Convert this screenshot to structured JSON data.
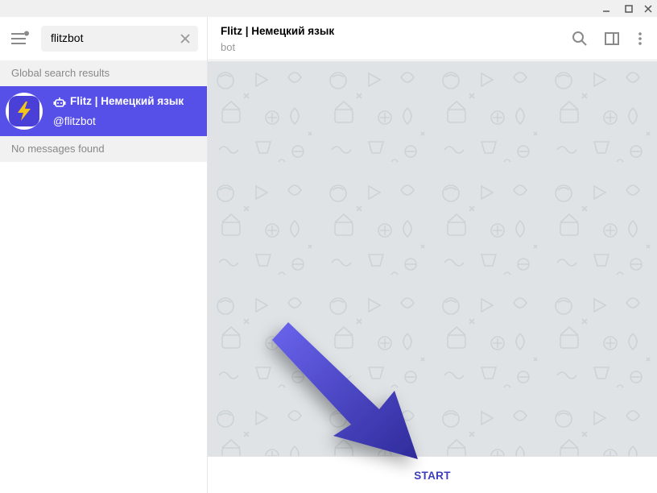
{
  "search": {
    "query": "flitzbot"
  },
  "left_panel": {
    "global_header": "Global search results",
    "result": {
      "name": "Flitz | Немецкий язык",
      "username": "@flitzbot"
    },
    "messages_header": "No messages found"
  },
  "chat": {
    "title": "Flitz | Немецкий язык",
    "subtitle": "bot"
  },
  "bottom": {
    "start_label": "START"
  },
  "icons": {
    "menu": "hamburger-menu-icon",
    "clear": "close-icon",
    "search": "search-icon",
    "sidebar": "sidebar-toggle-icon",
    "more": "more-vertical-icon",
    "bot": "bot-icon",
    "avatar": "lightning-bolt-icon"
  },
  "colors": {
    "accent": "#5750e8",
    "start": "#3d3dbd",
    "chat_bg": "#dfe3e6",
    "arrow": "#4a45c9"
  }
}
